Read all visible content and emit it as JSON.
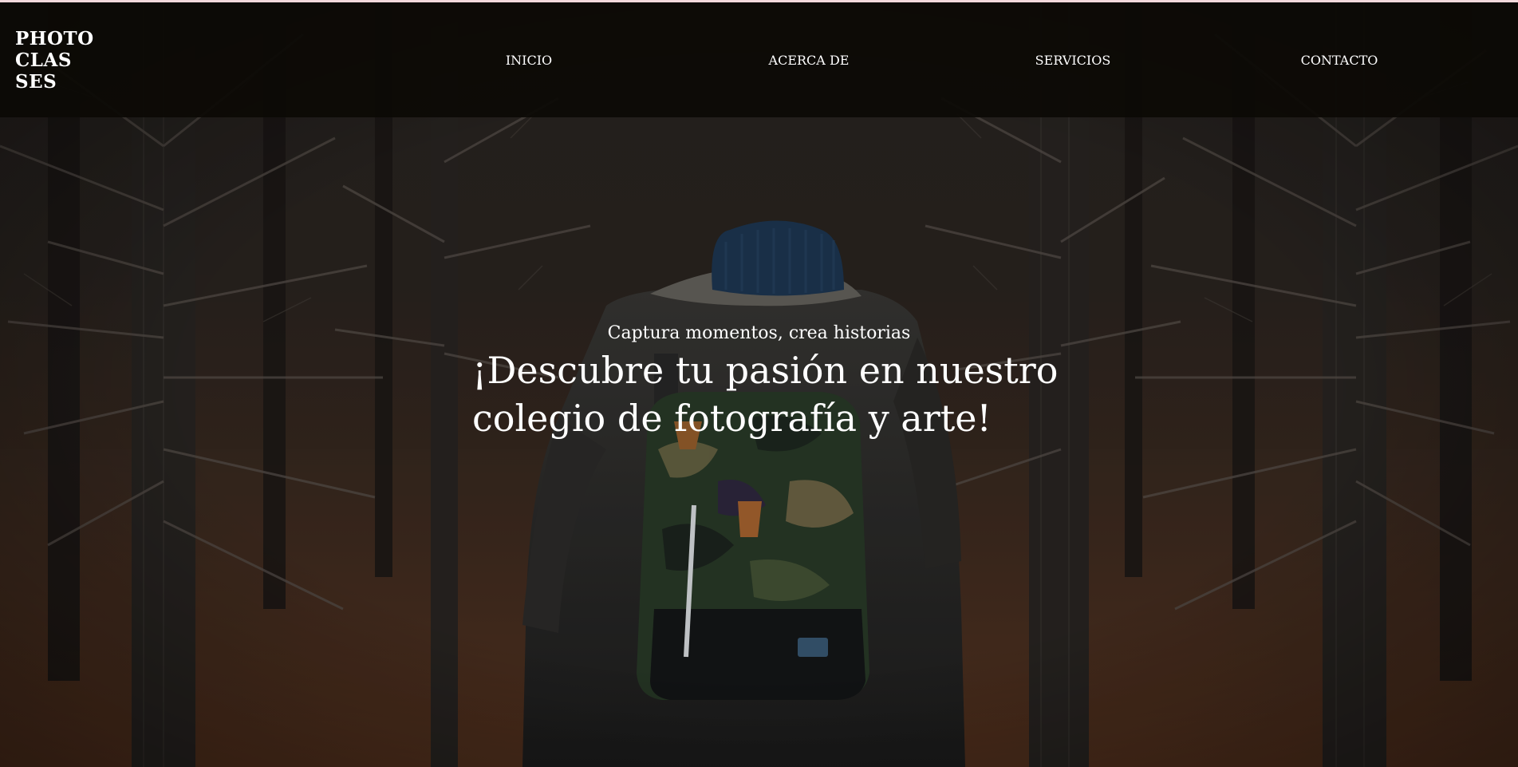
{
  "brand": {
    "logo_text": "PHOTO\nCLAS\nSES"
  },
  "nav": {
    "items": [
      {
        "label": "INICIO"
      },
      {
        "label": "ACERCA DE"
      },
      {
        "label": "SERVICIOS"
      },
      {
        "label": "CONTACTO"
      }
    ]
  },
  "hero": {
    "subtitle": "Captura momentos, crea historias",
    "title": "¡Descubre tu pasión en nuestro colegio de fotografía y arte!",
    "image_subject": "hiker-with-camo-backpack-in-forest"
  },
  "colors": {
    "nav_background": "#0c0a05",
    "text": "#ffffff",
    "top_strip": "#f3d9dc"
  }
}
